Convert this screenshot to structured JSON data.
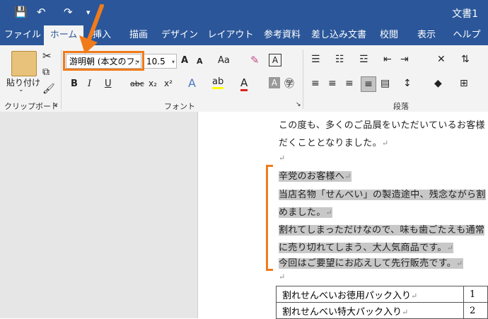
{
  "window": {
    "doc_title": "文書1"
  },
  "tabs": [
    "ファイル",
    "ホーム",
    "挿入",
    "描画",
    "デザイン",
    "レイアウト",
    "参考資料",
    "差し込み文書",
    "校閲",
    "表示",
    "ヘルプ"
  ],
  "active_tab": "ホーム",
  "clipboard": {
    "paste_label": "貼り付け",
    "group_label": "クリップボード"
  },
  "font": {
    "name": "游明朝 (本文のフ:",
    "size": "10.5",
    "group_label": "フォント",
    "bold": "B",
    "italic": "I",
    "underline": "U",
    "strike": "abc",
    "sub": "x₂",
    "sup": "x²",
    "grow": "A",
    "shrink": "A",
    "case": "Aa",
    "clear": "A"
  },
  "paragraph": {
    "group_label": "段落"
  },
  "document": {
    "lines": [
      "この度も、多くのご品屓をいただいているお客様",
      "だくこととなりました。"
    ],
    "selected_lines": [
      "辛党のお客様へ",
      "当店名物「せんべい」の製造途中、残念ながら割",
      "めました。",
      "割れてしまっただけなので、味も歯ごたえも通常",
      "に売り切れてしまう、大人気商品です。",
      "今回はご要望にお応えして先行販売です。"
    ],
    "table_rows": [
      {
        "name": "割れせんべいお徳用パック入り",
        "value": "1"
      },
      {
        "name": "割れせんべい特大パック入り",
        "value": "2"
      }
    ]
  },
  "colors": {
    "brand": "#2b579a",
    "highlight": "#f07b1b"
  }
}
